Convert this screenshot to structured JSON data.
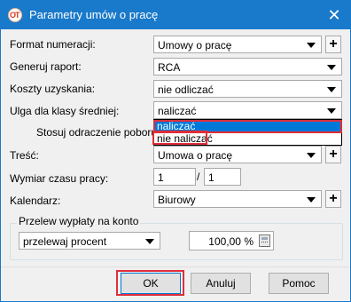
{
  "window": {
    "title": "Parametry umów o pracę"
  },
  "fields": {
    "format_label": "Format numeracji:",
    "format_value": "Umowy o pracę",
    "raport_label": "Generuj raport:",
    "raport_value": "RCA",
    "koszty_label": "Koszty uzyskania:",
    "koszty_value": "nie odliczać",
    "ulga_label": "Ulga dla klasy średniej:",
    "ulga_value": "naliczać",
    "odroczenie_label": "Stosuj odraczenie poboru zali",
    "tresc_label": "Treść:",
    "tresc_value": "Umowa o pracę",
    "wymiar_label": "Wymiar czasu pracy:",
    "wymiar_num": "1",
    "wymiar_sep": "/",
    "wymiar_den": "1",
    "kalendarz_label": "Kalendarz:",
    "kalendarz_value": "Biurowy"
  },
  "dropdown": {
    "options": [
      "naliczać",
      "nie naliczać"
    ],
    "selected_index": 0
  },
  "przelew": {
    "group_title": "Przelew wypłaty na konto",
    "mode_value": "przelewaj procent",
    "percent_value": "100,00 %"
  },
  "buttons": {
    "ok": "OK",
    "cancel": "Anuluj",
    "help": "Pomoc"
  },
  "icons": {
    "app": "comarch-icon",
    "plus": "+",
    "close": "✕"
  },
  "colors": {
    "titlebar": "#1979ca",
    "selection": "#0078d7",
    "annotation_highlight": "#e02e39"
  }
}
